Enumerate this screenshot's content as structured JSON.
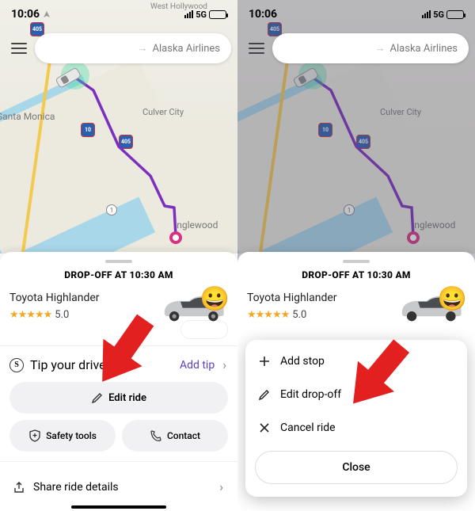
{
  "status": {
    "time": "10:06",
    "network": "5G"
  },
  "search": {
    "destination": "Alaska Airlines"
  },
  "map": {
    "labels": {
      "west_hollywood": "West\nHollywood",
      "santa_monica": "Santa Monica",
      "culver_city": "Culver City",
      "inglewood": "Inglewood"
    },
    "shields": {
      "r405": "405",
      "r10": "10"
    },
    "route_marker": "1"
  },
  "sheet": {
    "dropoff": "DROP-OFF AT 10:30 AM",
    "vehicle": "Toyota Highlander",
    "rating": "5.0",
    "tip_label": "Tip your driver",
    "add_tip": "Add tip",
    "edit_ride": "Edit ride",
    "safety": "Safety tools",
    "contact": "Contact",
    "share": "Share ride details"
  },
  "edit_menu": {
    "add_stop": "Add stop",
    "edit_dropoff": "Edit drop-off",
    "cancel_ride": "Cancel ride",
    "close": "Close"
  }
}
